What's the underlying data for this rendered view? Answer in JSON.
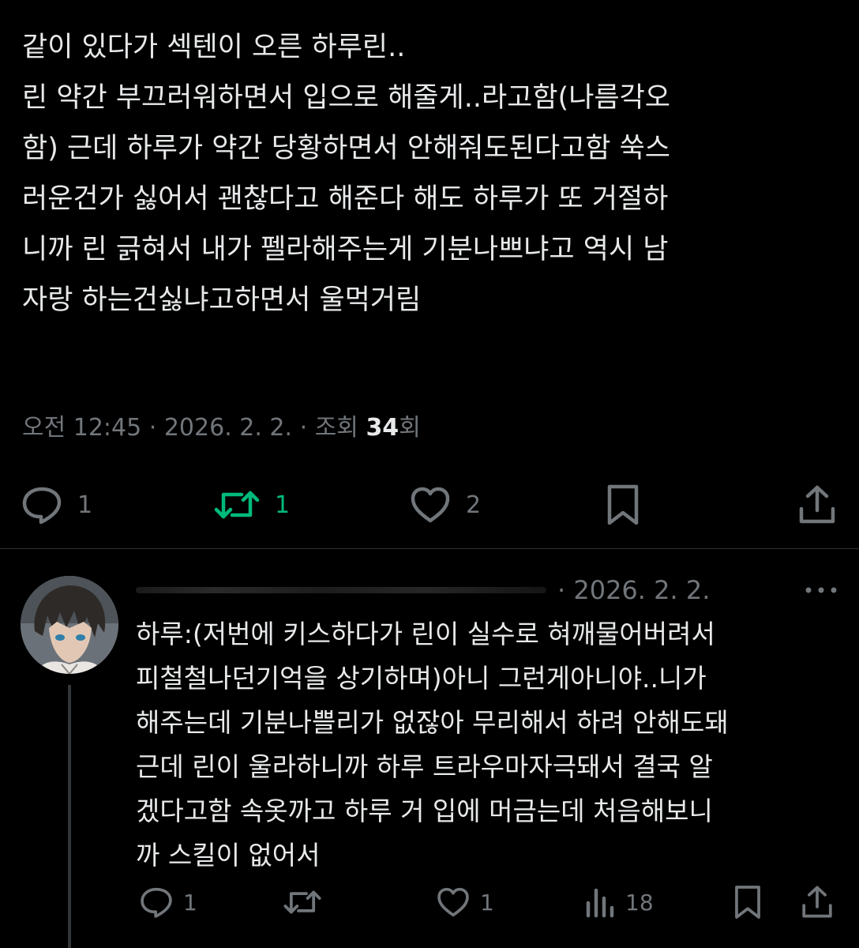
{
  "post": {
    "text_lines": [
      "같이 있다가 섹텐이 오른 하루린..",
      "린 약간 부끄러워하면서 입으로 해줄게..라고함(나름각오",
      "함) 근데 하루가 약간 당황하면서 안해줘도된다고함 쑥스",
      "러운건가 싫어서 괜찮다고 해준다 해도 하루가 또 거절하",
      "니까 린 긁혀서 내가 펠라해주는게 기분나쁘냐고 역시 남",
      "자랑 하는건싫냐고하면서 울먹거림"
    ],
    "meta": {
      "time": "오전 12:45",
      "separator": "·",
      "date": "2026. 2. 2.",
      "views_label": "조회",
      "views_count": "34",
      "views_suffix": "회"
    },
    "actions": {
      "reply_count": "1",
      "repost_count": "1",
      "like_count": "2"
    }
  },
  "reply": {
    "date": "· 2026. 2. 2.",
    "text_lines": [
      "하루:(저번에 키스하다가 린이 실수로 혀깨물어버려서",
      "피철철나던기억을 상기하며)아니 그런게아니야..니가",
      "해주는데 기분나쁠리가 없잖아 무리해서 하려 안해도돼",
      "근데 린이 울라하니까 하루 트라우마자극돼서 결국 알",
      "겠다고함 속옷까고 하루 거 입에 머금는데 처음해보니",
      "까 스킬이 없어서"
    ],
    "actions": {
      "reply_count": "1",
      "like_count": "1",
      "views_count": "18"
    }
  },
  "colors": {
    "background": "#000000",
    "text": "#e7e9ea",
    "muted": "#71767b",
    "repost_active": "#00ba7c",
    "divider": "#2f3336"
  },
  "icons": [
    "reply-icon",
    "repost-icon",
    "like-icon",
    "bookmark-icon",
    "share-icon",
    "more-icon",
    "views-icon"
  ]
}
